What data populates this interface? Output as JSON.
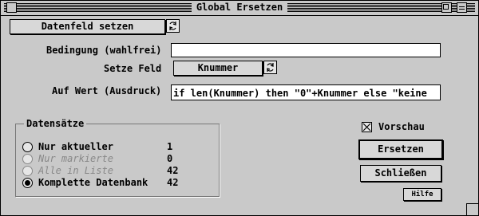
{
  "window": {
    "title": "Global Ersetzen"
  },
  "top_button": {
    "label": "Datenfeld setzen"
  },
  "condition": {
    "label": "Bedingung (wahlfrei)",
    "value": ""
  },
  "set_field": {
    "label": "Setze Feld",
    "button": "Knummer"
  },
  "value_expr": {
    "label": "Auf Wert (Ausdruck)",
    "value": "if len(Knummer) then \"0\"+Knummer else \"keine"
  },
  "records": {
    "title": "Datensätze",
    "options": [
      {
        "label": "Nur aktueller",
        "count": "1",
        "selected": false,
        "enabled": true
      },
      {
        "label": "Nur markierte",
        "count": "0",
        "selected": false,
        "enabled": false
      },
      {
        "label": "Alle in Liste",
        "count": "42",
        "selected": false,
        "enabled": false
      },
      {
        "label": "Komplette Datenbank",
        "count": "42",
        "selected": true,
        "enabled": true
      }
    ]
  },
  "preview": {
    "label": "Vorschau",
    "checked": true
  },
  "buttons": {
    "replace": "Ersetzen",
    "close": "Schließen",
    "help": "Hilfe"
  },
  "icons": {
    "popup": "popup-arrow-icon",
    "close": "close-box-icon",
    "zoom": "zoom-box-icon",
    "check": "check-x-icon"
  }
}
